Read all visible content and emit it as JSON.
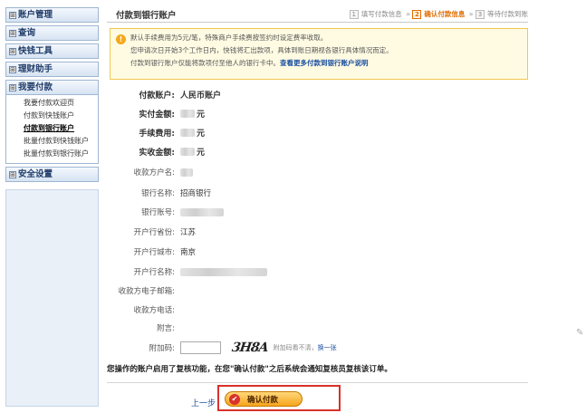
{
  "sidebar": {
    "menus": [
      {
        "label": "账户管理"
      },
      {
        "label": "查询"
      },
      {
        "label": "快钱工具"
      },
      {
        "label": "理财助手"
      },
      {
        "label": "我要付款"
      }
    ],
    "submenu": [
      {
        "label": "我要付款欢迎页"
      },
      {
        "label": "付款到快钱账户"
      },
      {
        "label": "付款到银行账户",
        "active": true
      },
      {
        "label": "批量付款到快钱账户"
      },
      {
        "label": "批量付款到银行账户"
      }
    ],
    "last_menu": {
      "label": "安全设置"
    },
    "expand_glyph": "⊞"
  },
  "header": {
    "title": "付款到银行账户",
    "steps": [
      {
        "num": "1",
        "label": "填写付款信息"
      },
      {
        "num": "2",
        "label": "确认付款信息"
      },
      {
        "num": "3",
        "label": "等待付款到账"
      }
    ]
  },
  "notice": {
    "line1": "默认手续费用为5元/笔，特殊商户手续费按签约时设定费率收取。",
    "line2": "您申请次日开始3个工作日内，快钱将汇出款项，具体到账日期视各银行具体情况而定。",
    "line3": "付款到银行账户仅能将款项付至他人的银行卡中。",
    "link": "查看更多付款到银行账户说明"
  },
  "form": {
    "account_label": "付款账户:",
    "account_value": "人民币账户",
    "actual_label": "实付金额:",
    "fee_label": "手续费用:",
    "received_label": "实收金额:",
    "currency_unit": "元",
    "payee_name_label": "收款方户名:",
    "bank_name_label": "银行名称:",
    "bank_name_value": "招商银行",
    "bank_account_label": "银行账号:",
    "province_label": "开户行省份:",
    "province_value": "江苏",
    "city_label": "开户行城市:",
    "city_value": "南京",
    "branch_label": "开户行名称:",
    "email_label": "收款方电子邮箱:",
    "phone_label": "收款方电话:",
    "memo_label": "附言:",
    "code_label": "附加码:",
    "captcha_text": "3H8A",
    "captcha_tip": "附加码看不清，",
    "captcha_refresh": "换一张"
  },
  "review_note": "您操作的账户启用了复核功能，在您\"确认付款\"之后系统会通知复核员复核该订单。",
  "actions": {
    "prev": "上一步",
    "confirm": "确认付款",
    "confirm_icon": "✔"
  },
  "colors": {
    "accent": "#e06d00",
    "link": "#1a4fa0",
    "highlight_frame": "#d8312b",
    "button": "#f6a51c"
  }
}
